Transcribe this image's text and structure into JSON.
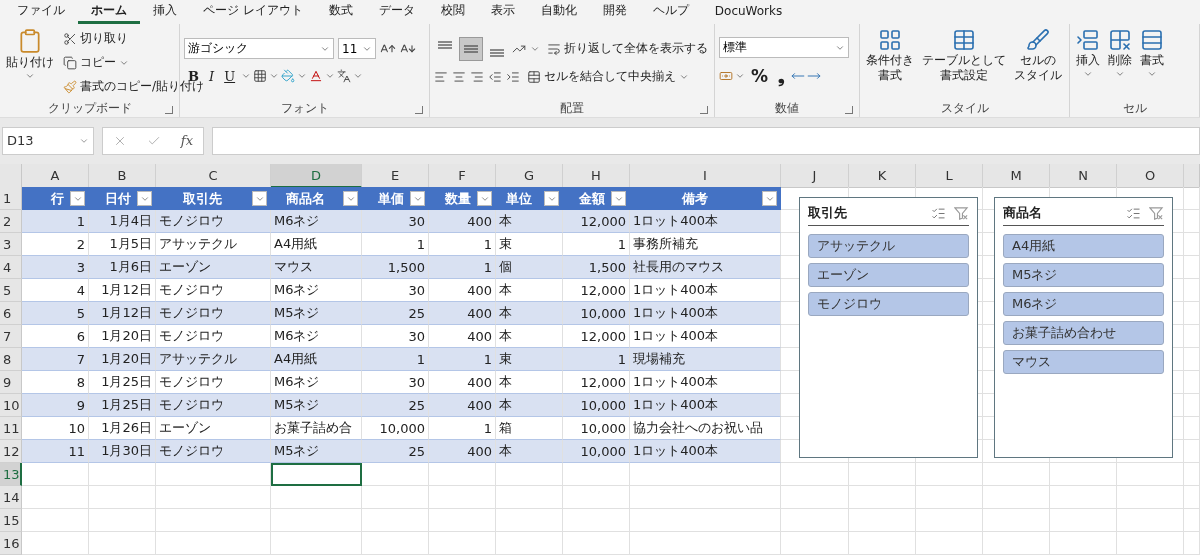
{
  "menu_tabs": [
    {
      "label": "ファイル",
      "selected": false
    },
    {
      "label": "ホーム",
      "selected": true
    },
    {
      "label": "挿入",
      "selected": false
    },
    {
      "label": "ページ レイアウト",
      "selected": false
    },
    {
      "label": "数式",
      "selected": false
    },
    {
      "label": "データ",
      "selected": false
    },
    {
      "label": "校閲",
      "selected": false
    },
    {
      "label": "表示",
      "selected": false
    },
    {
      "label": "自動化",
      "selected": false
    },
    {
      "label": "開発",
      "selected": false
    },
    {
      "label": "ヘルプ",
      "selected": false
    },
    {
      "label": "DocuWorks",
      "selected": false
    }
  ],
  "ribbon": {
    "clipboard": {
      "paste": "貼り付け",
      "cut": "切り取り",
      "copy": "コピー",
      "format_painter": "書式のコピー/貼り付け",
      "label": "クリップボード"
    },
    "font": {
      "font_name": "游ゴシック",
      "font_size": "11",
      "bold": "B",
      "italic": "I",
      "underline": "U",
      "label": "フォント"
    },
    "alignment": {
      "vertical": [
        {
          "selected": false
        },
        {
          "selected": true
        },
        {
          "selected": false
        }
      ],
      "wrap": "折り返して全体を表示する",
      "merge": "セルを結合して中央揃え",
      "label": "配置"
    },
    "number": {
      "format": "標準",
      "percent": "%",
      "comma": "❟",
      "label": "数値"
    },
    "styles": {
      "buttons": [
        {
          "kind": "conditional",
          "lines": [
            "条件付き",
            "書式"
          ]
        },
        {
          "kind": "table",
          "lines": [
            "テーブルとして",
            "書式設定"
          ]
        },
        {
          "kind": "cell",
          "lines": [
            "セルの",
            "スタイル"
          ]
        }
      ],
      "label": "スタイル"
    },
    "cells": {
      "buttons": [
        {
          "kind": "insert",
          "label": "挿入"
        },
        {
          "kind": "delete",
          "label": "削除"
        },
        {
          "kind": "format",
          "label": "書式"
        }
      ],
      "label": "セル"
    }
  },
  "formula_bar": {
    "name_box": "D13",
    "fx": "fx"
  },
  "sheet": {
    "column_letters": [
      {
        "label": "A",
        "selected": false
      },
      {
        "label": "B",
        "selected": false
      },
      {
        "label": "C",
        "selected": false
      },
      {
        "label": "D",
        "selected": true
      },
      {
        "label": "E",
        "selected": false
      },
      {
        "label": "F",
        "selected": false
      },
      {
        "label": "G",
        "selected": false
      },
      {
        "label": "H",
        "selected": false
      },
      {
        "label": "I",
        "selected": false
      },
      {
        "label": "J",
        "selected": false
      },
      {
        "label": "K",
        "selected": false
      },
      {
        "label": "L",
        "selected": false
      },
      {
        "label": "M",
        "selected": false
      },
      {
        "label": "N",
        "selected": false
      },
      {
        "label": "O",
        "selected": false
      }
    ],
    "row_numbers": [
      {
        "label": "1",
        "selected": false
      },
      {
        "label": "2",
        "selected": false
      },
      {
        "label": "3",
        "selected": false
      },
      {
        "label": "4",
        "selected": false
      },
      {
        "label": "5",
        "selected": false
      },
      {
        "label": "6",
        "selected": false
      },
      {
        "label": "7",
        "selected": false
      },
      {
        "label": "8",
        "selected": false
      },
      {
        "label": "9",
        "selected": false
      },
      {
        "label": "10",
        "selected": false
      },
      {
        "label": "11",
        "selected": false
      },
      {
        "label": "12",
        "selected": false
      },
      {
        "label": "13",
        "selected": true
      },
      {
        "label": "14",
        "selected": false
      },
      {
        "label": "15",
        "selected": false
      },
      {
        "label": "16",
        "selected": false
      }
    ],
    "table": {
      "columns": [
        {
          "header": "行",
          "kind": "number"
        },
        {
          "header": "日付",
          "kind": "number"
        },
        {
          "header": "取引先",
          "kind": "text"
        },
        {
          "header": "商品名",
          "kind": "text"
        },
        {
          "header": "単価",
          "kind": "number"
        },
        {
          "header": "数量",
          "kind": "number"
        },
        {
          "header": "単位",
          "kind": "text"
        },
        {
          "header": "金額",
          "kind": "number"
        },
        {
          "header": "備考",
          "kind": "text"
        }
      ],
      "rows": [
        [
          "1",
          "1月4日",
          "モノジロウ",
          "M6ネジ",
          "30",
          "400",
          "本",
          "12,000",
          "1ロット400本"
        ],
        [
          "2",
          "1月5日",
          "アサッテクル",
          "A4用紙",
          "1",
          "1",
          "束",
          "1",
          "事務所補充"
        ],
        [
          "3",
          "1月6日",
          "エーゾン",
          "マウス",
          "1,500",
          "1",
          "個",
          "1,500",
          "社長用のマウス"
        ],
        [
          "4",
          "1月12日",
          "モノジロウ",
          "M6ネジ",
          "30",
          "400",
          "本",
          "12,000",
          "1ロット400本"
        ],
        [
          "5",
          "1月12日",
          "モノジロウ",
          "M5ネジ",
          "25",
          "400",
          "本",
          "10,000",
          "1ロット400本"
        ],
        [
          "6",
          "1月20日",
          "モノジロウ",
          "M6ネジ",
          "30",
          "400",
          "本",
          "12,000",
          "1ロット400本"
        ],
        [
          "7",
          "1月20日",
          "アサッテクル",
          "A4用紙",
          "1",
          "1",
          "束",
          "1",
          "現場補充"
        ],
        [
          "8",
          "1月25日",
          "モノジロウ",
          "M6ネジ",
          "30",
          "400",
          "本",
          "12,000",
          "1ロット400本"
        ],
        [
          "9",
          "1月25日",
          "モノジロウ",
          "M5ネジ",
          "25",
          "400",
          "本",
          "10,000",
          "1ロット400本"
        ],
        [
          "10",
          "1月26日",
          "エーゾン",
          "お菓子詰め合",
          "10,000",
          "1",
          "箱",
          "10,000",
          "協力会社へのお祝い品"
        ],
        [
          "11",
          "1月30日",
          "モノジロウ",
          "M5ネジ",
          "25",
          "400",
          "本",
          "10,000",
          "1ロット400本"
        ]
      ]
    },
    "slicers": [
      {
        "title": "取引先",
        "items": [
          {
            "label": "アサッテクル",
            "selected": true
          },
          {
            "label": "エーゾン",
            "selected": true
          },
          {
            "label": "モノジロウ",
            "selected": true
          }
        ]
      },
      {
        "title": "商品名",
        "items": [
          {
            "label": "A4用紙",
            "selected": true
          },
          {
            "label": "M5ネジ",
            "selected": true
          },
          {
            "label": "M6ネジ",
            "selected": true
          },
          {
            "label": "お菓子詰め合わせ",
            "selected": true
          },
          {
            "label": "マウス",
            "selected": true
          }
        ]
      }
    ]
  }
}
